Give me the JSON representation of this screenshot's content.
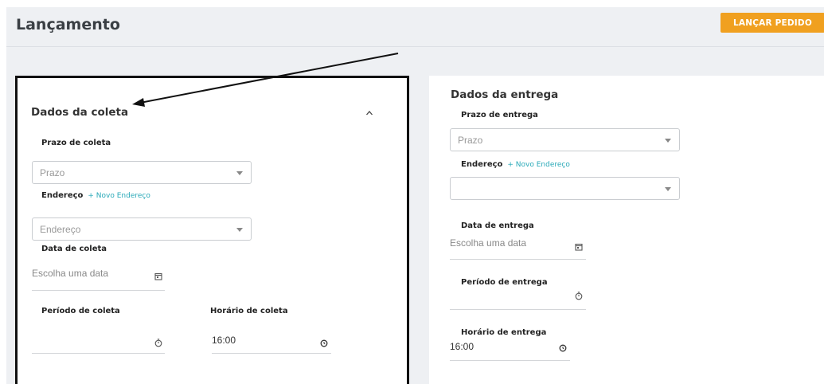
{
  "header": {
    "title": "Lançamento",
    "launch_label": "LANÇAR PEDIDO"
  },
  "collection": {
    "title": "Dados da coleta",
    "deadline_label": "Prazo de coleta",
    "deadline_placeholder": "Prazo",
    "address_label": "Endereço",
    "new_address_link": "+ Novo Endereço",
    "address_placeholder": "Endereço",
    "date_label": "Data de coleta",
    "date_placeholder": "Escolha uma data",
    "period_label": "Período de coleta",
    "time_label": "Horário de coleta",
    "time_value": "16:00"
  },
  "delivery": {
    "title": "Dados da entrega",
    "deadline_label": "Prazo de entrega",
    "deadline_placeholder": "Prazo",
    "address_label": "Endereço",
    "new_address_link": "+ Novo Endereço",
    "date_label": "Data de entrega",
    "date_placeholder": "Escolha uma data",
    "period_label": "Período de entrega",
    "time_label": "Horário de entrega",
    "time_value": "16:00"
  },
  "icons": {
    "collapse": "chevron-up-icon",
    "calendar": "calendar-icon",
    "timer": "stopwatch-icon",
    "clock": "clock-icon"
  },
  "colors": {
    "accent": "#f0a020",
    "link": "#29a9b8",
    "annotation": "#111111"
  }
}
